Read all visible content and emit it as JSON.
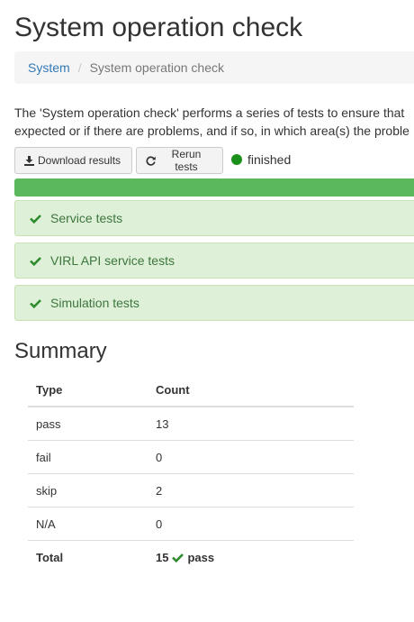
{
  "page": {
    "title": "System operation check"
  },
  "breadcrumb": {
    "items": [
      {
        "label": "System"
      }
    ],
    "separator": "/",
    "active": "System operation check"
  },
  "intro": {
    "line1": "The 'System operation check' performs a series of tests to ensure that",
    "line2": "expected or if there are problems, and if so, in which area(s) the proble"
  },
  "toolbar": {
    "download_label": "Download results",
    "rerun_label": "Rerun tests",
    "status_text": "finished",
    "progress_fraction": 1.0
  },
  "panels": [
    {
      "label": "Service tests",
      "icon": "check-icon"
    },
    {
      "label": "VIRL API service tests",
      "icon": "check-icon"
    },
    {
      "label": "Simulation tests",
      "icon": "check-icon"
    }
  ],
  "summary": {
    "title": "Summary",
    "headers": [
      "Type",
      "Count"
    ],
    "rows": [
      {
        "type": "pass",
        "count": "13"
      },
      {
        "type": "fail",
        "count": "0"
      },
      {
        "type": "skip",
        "count": "2"
      },
      {
        "type": "N/A",
        "count": "0"
      }
    ],
    "total": {
      "label": "Total",
      "count": "15",
      "result": "pass"
    }
  },
  "colors": {
    "accent_link": "#337ab7",
    "success_bar": "#5cb85c",
    "success_panel_bg": "#dff0d8",
    "success_text": "#3c763d",
    "status_dot": "#1a8f1a"
  }
}
